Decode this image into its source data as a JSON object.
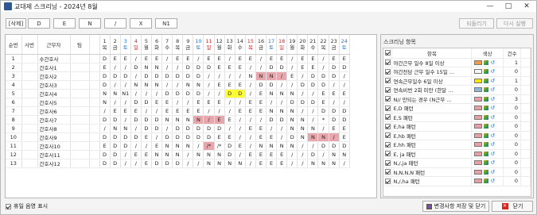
{
  "window": {
    "title": "교대제 스크리닝 - 2024년 8월",
    "minimize": "—",
    "maximize": "□",
    "close": "✕"
  },
  "toolbar": {
    "buttons": [
      "[삭제]",
      "D",
      "E",
      "N",
      "/",
      "X",
      "N1"
    ],
    "undo": "되돌리기",
    "redo": "다시 실행"
  },
  "grid": {
    "headers": {
      "order": "순번",
      "id": "사번",
      "worker": "근무자",
      "team": "팀"
    },
    "days": [
      {
        "n": "1",
        "w": "목",
        "c": ""
      },
      {
        "n": "2",
        "w": "금",
        "c": ""
      },
      {
        "n": "3",
        "w": "토",
        "c": "sat"
      },
      {
        "n": "4",
        "w": "일",
        "c": "sun"
      },
      {
        "n": "5",
        "w": "월",
        "c": ""
      },
      {
        "n": "6",
        "w": "화",
        "c": ""
      },
      {
        "n": "7",
        "w": "수",
        "c": ""
      },
      {
        "n": "8",
        "w": "목",
        "c": ""
      },
      {
        "n": "9",
        "w": "금",
        "c": ""
      },
      {
        "n": "10",
        "w": "토",
        "c": "sat"
      },
      {
        "n": "11",
        "w": "일",
        "c": "sun"
      },
      {
        "n": "12",
        "w": "월",
        "c": ""
      },
      {
        "n": "13",
        "w": "화",
        "c": ""
      },
      {
        "n": "14",
        "w": "수",
        "c": ""
      },
      {
        "n": "15",
        "w": "목",
        "c": "sun"
      },
      {
        "n": "16",
        "w": "금",
        "c": ""
      },
      {
        "n": "17",
        "w": "토",
        "c": "sat"
      },
      {
        "n": "18",
        "w": "일",
        "c": "sun"
      },
      {
        "n": "19",
        "w": "월",
        "c": ""
      },
      {
        "n": "20",
        "w": "화",
        "c": ""
      },
      {
        "n": "21",
        "w": "수",
        "c": ""
      },
      {
        "n": "22",
        "w": "목",
        "c": ""
      },
      {
        "n": "23",
        "w": "금",
        "c": ""
      },
      {
        "n": "24",
        "w": "토",
        "c": "sat"
      }
    ],
    "rows": [
      {
        "no": "1",
        "name": "수간호사",
        "cells": [
          "D",
          "E",
          "E",
          "/",
          "E",
          "E",
          "/",
          "E",
          "E",
          "/",
          "E",
          "E",
          "/",
          "E",
          "E",
          "/",
          "E",
          "E",
          "/",
          "E",
          "E",
          "/",
          "E",
          "E"
        ]
      },
      {
        "no": "2",
        "name": "간호사1",
        "cells": [
          "E",
          "/",
          "/",
          "D",
          "N",
          "N",
          "/",
          "/",
          "D",
          "D",
          "D",
          "E",
          "E",
          "E",
          "/",
          "/",
          "D",
          "D",
          "/",
          "E",
          "E",
          "/",
          "D",
          "D"
        ]
      },
      {
        "no": "3",
        "name": "간호사2",
        "cells": [
          "D",
          "D",
          "D",
          "/",
          "D",
          "D",
          "D",
          "D",
          "D",
          "D",
          "/",
          "/",
          "/",
          "/",
          "N",
          "N",
          "N",
          "/",
          "E",
          "/",
          "D",
          "D",
          "D",
          "/"
        ]
      },
      {
        "no": "4",
        "name": "간호사3",
        "cells": [
          "D",
          "/",
          "/",
          "N",
          "N",
          "N",
          "/",
          "/",
          "N",
          "N",
          "/",
          "E",
          "E",
          "E",
          "/",
          "D",
          "D",
          "/",
          "/",
          "D",
          "D",
          "D",
          "/",
          "/"
        ]
      },
      {
        "no": "5",
        "name": "간호사4",
        "cells": [
          "N",
          "N",
          "N1",
          "/",
          "/",
          "/",
          "D",
          "D",
          "D",
          "D",
          "/",
          "/",
          "D",
          "D",
          "/",
          "E",
          "N",
          "N",
          "N",
          "/",
          "/",
          "E",
          "E",
          "E"
        ]
      },
      {
        "no": "6",
        "name": "간호사5",
        "cells": [
          "N",
          "/",
          "/",
          "D",
          "D",
          "E",
          "E",
          "/",
          "/",
          "E",
          "E",
          "E",
          "/",
          "/",
          "E",
          "E",
          "/",
          "/",
          "D",
          "D",
          "D",
          "E",
          "/",
          "/"
        ]
      },
      {
        "no": "7",
        "name": "간호사6",
        "cells": [
          "/",
          "E",
          "E",
          "E",
          "/",
          "/",
          "E",
          "E",
          "E",
          "E",
          "/",
          "/",
          "/",
          "E",
          "E",
          "E",
          "N",
          "N",
          "N",
          "/",
          "/",
          "D",
          "D",
          "D"
        ]
      },
      {
        "no": "8",
        "name": "간호사7",
        "cells": [
          "D",
          "D",
          "/",
          "D",
          "D",
          "D",
          "N",
          "N",
          "N",
          "N",
          "/",
          "E",
          "E",
          "/",
          "/",
          "/",
          "D",
          "D",
          "N",
          "N",
          "/",
          "*",
          "D",
          "D"
        ]
      },
      {
        "no": "9",
        "name": "간호사8",
        "cells": [
          "/",
          "N",
          "N",
          "/",
          "D",
          "D",
          "/",
          "D",
          "D",
          "D",
          "D",
          "D",
          "/",
          "/",
          "E",
          "E",
          "/",
          "/",
          "N",
          "N",
          "N",
          "/",
          "E",
          "E"
        ]
      },
      {
        "no": "10",
        "name": "간호사9",
        "cells": [
          "D",
          "D",
          "D",
          "D",
          "E",
          "/",
          "D",
          "D",
          "D",
          "D",
          "D",
          "E",
          "E",
          "/",
          "/",
          "E",
          "E",
          "/",
          "D",
          "N",
          "N",
          "N",
          "/",
          "E"
        ]
      },
      {
        "no": "11",
        "name": "간호사10",
        "cells": [
          "E",
          "D",
          "D",
          "/",
          "/",
          "E",
          "N",
          "N",
          "N",
          "/",
          "/*",
          "/*",
          "D",
          "E",
          "/",
          "N",
          "N",
          "N",
          "N",
          "/",
          "/",
          "D",
          "D",
          "D"
        ]
      },
      {
        "no": "12",
        "name": "간호사11",
        "cells": [
          "D",
          "D",
          "/",
          "E",
          "E",
          "N",
          "N",
          "N",
          "/",
          "N",
          "N",
          "N",
          "D",
          "/",
          "E",
          "E",
          "E",
          "E",
          "/",
          "/",
          "D",
          "/",
          "N",
          "N"
        ]
      },
      {
        "no": "13",
        "name": "간호사12",
        "cells": [
          "D",
          "D",
          "/",
          "/",
          "E",
          "D",
          "D",
          "D",
          "/",
          "/",
          "N",
          "N",
          "N",
          "N",
          "/",
          "E",
          "E",
          "E",
          "/",
          "/",
          "N",
          "N",
          "N",
          "/"
        ]
      }
    ]
  },
  "screening": {
    "title": "스크리닝 항목",
    "headers": {
      "item": "항목",
      "color": "색상",
      "count": "건수"
    },
    "rules": [
      {
        "checked": true,
        "label": "야간근무 일수 8일 이상",
        "color": "#f2994a",
        "count": "1"
      },
      {
        "checked": true,
        "label": "야간전담 근무 일수 15일 ...",
        "color": "#f5f5f5",
        "count": "0"
      },
      {
        "checked": true,
        "label": "연속근무일수 6일 이상",
        "color": "#ffe600",
        "count": "1"
      },
      {
        "checked": true,
        "label": "연속비번 2회 미만 (한달 ...",
        "color": "#8fb7e0",
        "count": "0"
      },
      {
        "checked": true,
        "label": "N// 만되는 경우 (N근무 ...",
        "color": "#e8a0a8",
        "count": "3"
      },
      {
        "checked": true,
        "label": "E,D 패턴",
        "color": "#e8a0a8",
        "count": "0"
      },
      {
        "checked": true,
        "label": "E,S 패턴",
        "color": "#e8a0a8",
        "count": "0"
      },
      {
        "checked": true,
        "label": "E,ha 패턴",
        "color": "#e8a0a8",
        "count": "0"
      },
      {
        "checked": true,
        "label": "E,hb 패턴",
        "color": "#e8a0a8",
        "count": "0"
      },
      {
        "checked": true,
        "label": "E,hh 패턴",
        "color": "#e8a0a8",
        "count": "0"
      },
      {
        "checked": true,
        "label": "E, ja 패턴",
        "color": "#e8a0a8",
        "count": "0"
      },
      {
        "checked": true,
        "label": "N,/,ja 패턴",
        "color": "#e8a0a8",
        "count": "0"
      },
      {
        "checked": true,
        "label": "N,N,N,N 패턴",
        "color": "#e8a0a8",
        "count": "0"
      },
      {
        "checked": true,
        "label": "N,/,ha 패턴",
        "color": "#e8a0a8",
        "count": "0"
      }
    ]
  },
  "footer": {
    "holiday_label": "휴일 음영 표시",
    "save_label": "변경사항 저장 및 닫기",
    "close_label": "닫기"
  }
}
